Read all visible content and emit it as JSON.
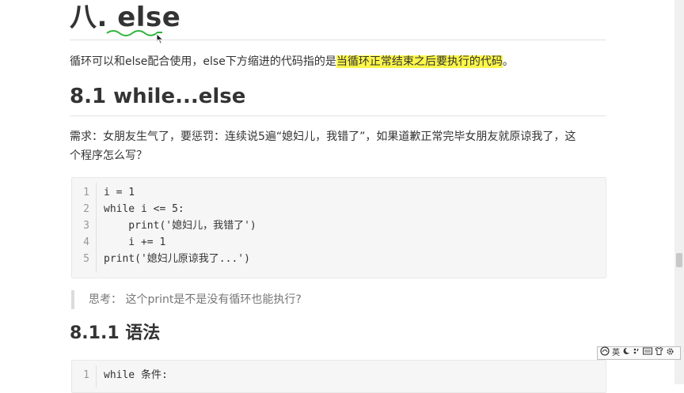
{
  "section": {
    "title": "八. else",
    "intro_plain": "循环可以和else配合使用，else下方缩进的代码指的是",
    "intro_highlight": "当循环正常结束之后要执行的代码",
    "intro_end": "。"
  },
  "subsection": {
    "title": "8.1 while...else",
    "requirement_line1": "需求：女朋友生气了，要惩罚：连续说5遍“媳妇儿，我错了”，如果道歉正常完毕女朋友就原谅我了，这",
    "requirement_line2": "个程序怎么写？"
  },
  "code1": {
    "lines": [
      {
        "n": "1",
        "text": "i = 1"
      },
      {
        "n": "2",
        "text": "while i <= 5:"
      },
      {
        "n": "3",
        "text": "    print('媳妇儿，我错了')"
      },
      {
        "n": "4",
        "text": "    i += 1"
      },
      {
        "n": "5",
        "text": "print('媳妇儿原谅我了...')"
      }
    ]
  },
  "quote": {
    "text": "思考：  这个print是不是没有循环也能执行?"
  },
  "subsubsection": {
    "title": "8.1.1 语法"
  },
  "code2": {
    "lines": [
      {
        "n": "1",
        "text": "while 条件:"
      }
    ]
  },
  "ime_toolbar": {
    "mode": "英",
    "items": [
      "logo-icon",
      "moon-icon",
      "punctuation-icon",
      "keyboard-icon",
      "shirt-icon",
      "gear-icon"
    ]
  }
}
